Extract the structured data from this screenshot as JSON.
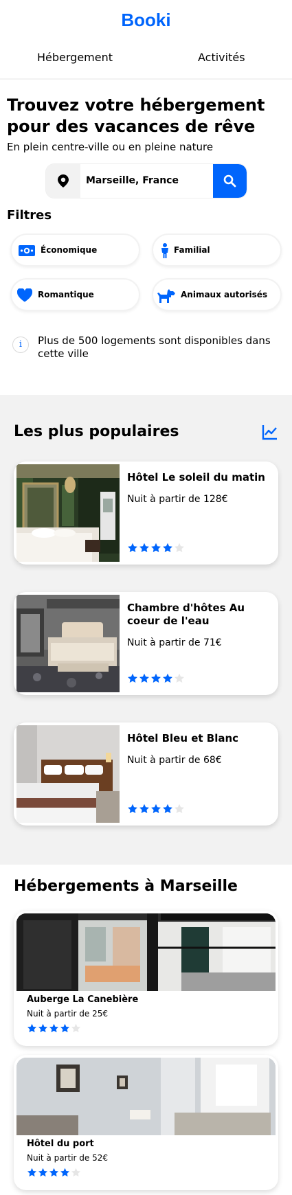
{
  "brand": {
    "logo": "Booki",
    "accent_color": "#0065fc"
  },
  "nav": {
    "tabs": [
      {
        "label": "Hébergement"
      },
      {
        "label": "Activités"
      }
    ]
  },
  "hero": {
    "title": "Trouvez votre hébergement pour des vacances de rêve",
    "subtitle": "En plein centre-ville ou en pleine nature"
  },
  "search": {
    "value": "Marseille, France",
    "icon": "map-pin-icon",
    "button_icon": "search-icon"
  },
  "filters": {
    "title": "Filtres",
    "items": [
      {
        "label": "Économique",
        "icon": "money-icon"
      },
      {
        "label": "Familial",
        "icon": "child-icon"
      },
      {
        "label": "Romantique",
        "icon": "heart-icon"
      },
      {
        "label": "Animaux autorisés",
        "icon": "dog-icon"
      }
    ]
  },
  "info": {
    "text": "Plus de 500 logements sont disponibles dans cette ville",
    "icon": "info-icon"
  },
  "popular": {
    "title": "Les plus populaires",
    "icon": "chart-line-icon",
    "cards": [
      {
        "name": "Hôtel Le soleil du matin",
        "price": "Nuit à partir de 128€",
        "rating": 4,
        "max_rating": 5
      },
      {
        "name": "Chambre d'hôtes Au coeur de l'eau",
        "price": "Nuit à partir de 71€",
        "rating": 4,
        "max_rating": 5
      },
      {
        "name": "Hôtel Bleu et Blanc",
        "price": "Nuit à partir de 68€",
        "rating": 4,
        "max_rating": 5
      }
    ]
  },
  "marseille": {
    "title": "Hébergements à Marseille",
    "cards": [
      {
        "name": "Auberge La Canebière",
        "price": "Nuit à partir de 25€",
        "rating": 4,
        "max_rating": 5
      },
      {
        "name": "Hôtel du port",
        "price": "Nuit à partir de 52€",
        "rating": 4,
        "max_rating": 5
      }
    ]
  }
}
